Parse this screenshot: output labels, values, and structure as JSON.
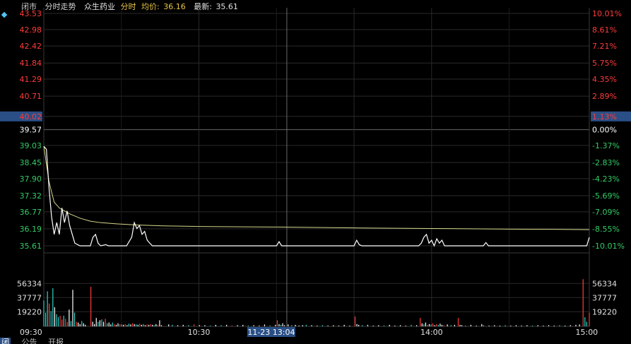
{
  "header": {
    "status": "闭市",
    "mode": "分时走势",
    "stock_name": "众生药业",
    "period": "分时",
    "avg_label": "均价:",
    "avg_value": "36.16",
    "latest_label": "最新:",
    "latest_value": "35.61"
  },
  "tabs": [
    {
      "label": "闭",
      "active": true
    },
    {
      "label": "公告",
      "active": false
    },
    {
      "label": "开报",
      "active": false
    }
  ],
  "colors": {
    "up": "#ff3b3b",
    "down": "#33cc66",
    "neutral": "#ffffff",
    "price_line": "#ffffff",
    "avg_line": "#d6d68a",
    "grid": "#2a2a2a",
    "highlight": "#2a4f86",
    "teal_bar": "#2fd2c7"
  },
  "crosshair_time": "11-23 13:04",
  "chart_data": {
    "type": "line",
    "title": "",
    "xlabel": "",
    "ylabel": "",
    "ylim": [
      35.61,
      43.53
    ],
    "prev_close": 39.57,
    "highlight_price": "40.02",
    "highlight_pct": "1.13%",
    "y_ticks_left": [
      "43.53",
      "42.98",
      "42.42",
      "41.84",
      "41.29",
      "40.71",
      "40.02",
      "39.57",
      "39.03",
      "38.45",
      "37.90",
      "37.32",
      "36.77",
      "36.19",
      "35.61"
    ],
    "y_tick_values": [
      43.53,
      42.98,
      42.42,
      41.84,
      41.29,
      40.71,
      40.02,
      39.57,
      39.03,
      38.45,
      37.9,
      37.32,
      36.77,
      36.19,
      35.61
    ],
    "y_ticks_right": [
      "10.01%",
      "8.61%",
      "7.21%",
      "5.75%",
      "4.35%",
      "2.89%",
      "1.13%",
      "0.00%",
      "-1.37%",
      "-2.83%",
      "-4.23%",
      "-5.69%",
      "-7.09%",
      "-8.55%",
      "-10.01%"
    ],
    "x_ticks": [
      "09:30",
      "10:30",
      "14:00",
      "15:00"
    ],
    "x_tick_minutes": [
      0,
      60,
      150,
      210
    ],
    "volume_ticks": [
      "56334",
      "37777",
      "19220"
    ],
    "volume_tick_values": [
      56334,
      37777,
      19220
    ],
    "volume_ylim": [
      0,
      90000
    ],
    "series": [
      {
        "role": "price",
        "points": [
          [
            0,
            39.0
          ],
          [
            1,
            38.9
          ],
          [
            2,
            37.6
          ],
          [
            3,
            36.6
          ],
          [
            4,
            36.0
          ],
          [
            5,
            36.4
          ],
          [
            6,
            36.0
          ],
          [
            7,
            36.9
          ],
          [
            8,
            36.4
          ],
          [
            9,
            36.8
          ],
          [
            10,
            36.3
          ],
          [
            11,
            36.0
          ],
          [
            12,
            35.7
          ],
          [
            14,
            35.61
          ],
          [
            16,
            35.61
          ],
          [
            18,
            35.61
          ],
          [
            19,
            35.9
          ],
          [
            20,
            36.0
          ],
          [
            21,
            35.7
          ],
          [
            22,
            35.61
          ],
          [
            24,
            35.65
          ],
          [
            25,
            35.61
          ],
          [
            28,
            35.61
          ],
          [
            30,
            35.61
          ],
          [
            32,
            35.61
          ],
          [
            34,
            35.9
          ],
          [
            35,
            36.4
          ],
          [
            36,
            36.2
          ],
          [
            37,
            36.3
          ],
          [
            38,
            36.0
          ],
          [
            39,
            36.1
          ],
          [
            40,
            35.8
          ],
          [
            41,
            35.7
          ],
          [
            42,
            35.61
          ],
          [
            45,
            35.61
          ],
          [
            60,
            35.61
          ],
          [
            80,
            35.61
          ],
          [
            90,
            35.61
          ],
          [
            91,
            35.75
          ],
          [
            92,
            35.61
          ],
          [
            110,
            35.61
          ],
          [
            120,
            35.61
          ],
          [
            121,
            35.8
          ],
          [
            122,
            35.65
          ],
          [
            123,
            35.61
          ],
          [
            145,
            35.61
          ],
          [
            146,
            35.7
          ],
          [
            147,
            35.9
          ],
          [
            148,
            36.0
          ],
          [
            149,
            35.7
          ],
          [
            150,
            35.8
          ],
          [
            151,
            35.61
          ],
          [
            152,
            35.85
          ],
          [
            153,
            35.7
          ],
          [
            154,
            35.8
          ],
          [
            155,
            35.61
          ],
          [
            160,
            35.61
          ],
          [
            170,
            35.61
          ],
          [
            171,
            35.72
          ],
          [
            172,
            35.61
          ],
          [
            200,
            35.61
          ],
          [
            205,
            35.61
          ],
          [
            209,
            35.61
          ],
          [
            210,
            35.61
          ],
          [
            211,
            35.9
          ]
        ]
      },
      {
        "role": "average",
        "points": [
          [
            0,
            39.0
          ],
          [
            2,
            37.8
          ],
          [
            4,
            37.1
          ],
          [
            6,
            36.9
          ],
          [
            8,
            36.8
          ],
          [
            10,
            36.7
          ],
          [
            14,
            36.55
          ],
          [
            18,
            36.45
          ],
          [
            22,
            36.4
          ],
          [
            28,
            36.36
          ],
          [
            36,
            36.32
          ],
          [
            46,
            36.29
          ],
          [
            60,
            36.27
          ],
          [
            90,
            36.25
          ],
          [
            120,
            36.22
          ],
          [
            150,
            36.2
          ],
          [
            180,
            36.18
          ],
          [
            200,
            36.17
          ],
          [
            211,
            36.16
          ]
        ]
      }
    ],
    "volume": [
      [
        0,
        34000,
        "teal"
      ],
      [
        0.7,
        18000,
        "teal"
      ],
      [
        1.4,
        46000,
        "teal"
      ],
      [
        2.1,
        30000,
        "up"
      ],
      [
        2.8,
        20000,
        "teal"
      ],
      [
        3.5,
        50000,
        "teal"
      ],
      [
        4.2,
        25000,
        "neutral"
      ],
      [
        4.9,
        16000,
        "teal"
      ],
      [
        5.6,
        12000,
        "teal"
      ],
      [
        6.3,
        14000,
        "up"
      ],
      [
        7,
        9000,
        "up"
      ],
      [
        7.7,
        14000,
        "teal"
      ],
      [
        8.4,
        10000,
        "up"
      ],
      [
        9.1,
        6000,
        "up"
      ],
      [
        9.8,
        22000,
        "neutral"
      ],
      [
        10.5,
        7000,
        "teal"
      ],
      [
        11.2,
        48000,
        "neutral"
      ],
      [
        11.9,
        18000,
        "teal"
      ],
      [
        12.6,
        6000,
        "up"
      ],
      [
        13.3,
        5000,
        "neutral"
      ],
      [
        14,
        3000,
        "neutral"
      ],
      [
        14.7,
        7000,
        "teal"
      ],
      [
        15.4,
        4000,
        "neutral"
      ],
      [
        16.1,
        2000,
        "neutral"
      ],
      [
        18.2,
        52000,
        "up"
      ],
      [
        18.9,
        6000,
        "neutral"
      ],
      [
        19.6,
        3000,
        "neutral"
      ],
      [
        20.3,
        11000,
        "neutral"
      ],
      [
        21,
        6000,
        "teal"
      ],
      [
        21.7,
        8000,
        "neutral"
      ],
      [
        22.4,
        9000,
        "teal"
      ],
      [
        23.1,
        6000,
        "neutral"
      ],
      [
        23.8,
        10000,
        "up"
      ],
      [
        24.5,
        4000,
        "teal"
      ],
      [
        25.2,
        5000,
        "neutral"
      ],
      [
        25.9,
        2500,
        "neutral"
      ],
      [
        26.6,
        5000,
        "teal"
      ],
      [
        27.3,
        3000,
        "up"
      ],
      [
        28,
        2000,
        "neutral"
      ],
      [
        28.7,
        4000,
        "neutral"
      ],
      [
        29.4,
        3000,
        "up"
      ],
      [
        30.1,
        2500,
        "teal"
      ],
      [
        30.8,
        2000,
        "neutral"
      ],
      [
        31.5,
        3000,
        "up"
      ],
      [
        32.2,
        1500,
        "neutral"
      ],
      [
        32.9,
        3500,
        "teal"
      ],
      [
        33.6,
        2500,
        "neutral"
      ],
      [
        34.3,
        4000,
        "up"
      ],
      [
        35,
        3000,
        "neutral"
      ],
      [
        35.7,
        2500,
        "teal"
      ],
      [
        36.4,
        2000,
        "neutral"
      ],
      [
        37.1,
        3500,
        "up"
      ],
      [
        37.8,
        2000,
        "neutral"
      ],
      [
        38.5,
        3000,
        "teal"
      ],
      [
        39.2,
        1500,
        "neutral"
      ],
      [
        39.9,
        2500,
        "up"
      ],
      [
        40.6,
        2000,
        "neutral"
      ],
      [
        41.3,
        3000,
        "up"
      ],
      [
        42,
        2000,
        "neutral"
      ],
      [
        42.7,
        1500,
        "teal"
      ],
      [
        43.4,
        3000,
        "neutral"
      ],
      [
        44.1,
        2000,
        "up"
      ],
      [
        44.8,
        8000,
        "neutral"
      ],
      [
        45.5,
        1500,
        "neutral"
      ],
      [
        48.3,
        2500,
        "neutral"
      ],
      [
        49.7,
        2000,
        "teal"
      ],
      [
        51.8,
        1500,
        "neutral"
      ],
      [
        53.9,
        2000,
        "neutral"
      ],
      [
        56,
        1500,
        "teal"
      ],
      [
        58.1,
        2500,
        "up"
      ],
      [
        60.2,
        1500,
        "neutral"
      ],
      [
        62.3,
        1500,
        "neutral"
      ],
      [
        64.4,
        1000,
        "teal"
      ],
      [
        66.5,
        2000,
        "neutral"
      ],
      [
        68.6,
        1500,
        "teal"
      ],
      [
        70.7,
        2000,
        "neutral"
      ],
      [
        72.8,
        1000,
        "up"
      ],
      [
        74.9,
        1500,
        "neutral"
      ],
      [
        77,
        2000,
        "neutral"
      ],
      [
        79.1,
        1000,
        "teal"
      ],
      [
        81.2,
        1500,
        "neutral"
      ],
      [
        83.3,
        1000,
        "neutral"
      ],
      [
        85.4,
        2500,
        "neutral"
      ],
      [
        87.5,
        1000,
        "teal"
      ],
      [
        89.6,
        2000,
        "neutral"
      ],
      [
        90.3,
        8000,
        "up"
      ],
      [
        91,
        3000,
        "neutral"
      ],
      [
        91.7,
        2000,
        "teal"
      ],
      [
        92.4,
        4000,
        "neutral"
      ],
      [
        93.1,
        1500,
        "neutral"
      ],
      [
        94.5,
        2500,
        "neutral"
      ],
      [
        95.9,
        1500,
        "teal"
      ],
      [
        97.3,
        2000,
        "neutral"
      ],
      [
        98.7,
        1000,
        "neutral"
      ],
      [
        100.1,
        1500,
        "neutral"
      ],
      [
        101.5,
        2000,
        "teal"
      ],
      [
        103.6,
        1500,
        "neutral"
      ],
      [
        105.7,
        1000,
        "neutral"
      ],
      [
        107.8,
        1500,
        "teal"
      ],
      [
        109.9,
        1000,
        "neutral"
      ],
      [
        112,
        1500,
        "neutral"
      ],
      [
        114.1,
        1000,
        "neutral"
      ],
      [
        116.2,
        2000,
        "neutral"
      ],
      [
        118.3,
        1000,
        "neutral"
      ],
      [
        120.4,
        13000,
        "up"
      ],
      [
        121.1,
        3000,
        "neutral"
      ],
      [
        121.8,
        2000,
        "neutral"
      ],
      [
        123.2,
        1500,
        "teal"
      ],
      [
        125.3,
        2000,
        "neutral"
      ],
      [
        127.4,
        1000,
        "neutral"
      ],
      [
        129.5,
        1500,
        "neutral"
      ],
      [
        131.6,
        1000,
        "teal"
      ],
      [
        133.7,
        2000,
        "neutral"
      ],
      [
        135.8,
        1000,
        "neutral"
      ],
      [
        137.9,
        1500,
        "neutral"
      ],
      [
        140,
        1000,
        "neutral"
      ],
      [
        142.1,
        2000,
        "teal"
      ],
      [
        144.2,
        1500,
        "neutral"
      ],
      [
        145.6,
        11000,
        "up"
      ],
      [
        146.3,
        4000,
        "neutral"
      ],
      [
        147,
        3000,
        "teal"
      ],
      [
        147.7,
        5000,
        "neutral"
      ],
      [
        148.4,
        2000,
        "up"
      ],
      [
        149.1,
        3000,
        "neutral"
      ],
      [
        149.8,
        2500,
        "teal"
      ],
      [
        150.5,
        4000,
        "up"
      ],
      [
        151.2,
        1500,
        "neutral"
      ],
      [
        151.9,
        3000,
        "up"
      ],
      [
        152.6,
        2000,
        "teal"
      ],
      [
        153.3,
        3500,
        "neutral"
      ],
      [
        154,
        2000,
        "neutral"
      ],
      [
        154.7,
        1500,
        "up"
      ],
      [
        156.1,
        2500,
        "neutral"
      ],
      [
        157.5,
        1500,
        "teal"
      ],
      [
        158.9,
        2000,
        "neutral"
      ],
      [
        160.3,
        11000,
        "up"
      ],
      [
        161,
        2000,
        "neutral"
      ],
      [
        161.7,
        1500,
        "neutral"
      ],
      [
        163.1,
        1000,
        "teal"
      ],
      [
        165.2,
        2000,
        "neutral"
      ],
      [
        167.3,
        1000,
        "neutral"
      ],
      [
        169.4,
        3000,
        "neutral"
      ],
      [
        170.1,
        1500,
        "teal"
      ],
      [
        172.2,
        1000,
        "neutral"
      ],
      [
        174.3,
        1500,
        "neutral"
      ],
      [
        176.4,
        1000,
        "neutral"
      ],
      [
        178.5,
        1500,
        "teal"
      ],
      [
        180.6,
        1000,
        "neutral"
      ],
      [
        182.7,
        1500,
        "neutral"
      ],
      [
        184.8,
        1000,
        "neutral"
      ],
      [
        186.9,
        1500,
        "neutral"
      ],
      [
        189,
        1000,
        "teal"
      ],
      [
        191.1,
        1500,
        "neutral"
      ],
      [
        193.2,
        1000,
        "neutral"
      ],
      [
        195.3,
        1500,
        "neutral"
      ],
      [
        197.4,
        1000,
        "neutral"
      ],
      [
        199.5,
        1500,
        "teal"
      ],
      [
        201.6,
        1000,
        "neutral"
      ],
      [
        203.7,
        1500,
        "neutral"
      ],
      [
        205.8,
        2000,
        "neutral"
      ],
      [
        207.2,
        2500,
        "neutral"
      ],
      [
        208.6,
        62000,
        "up"
      ],
      [
        209.3,
        12000,
        "teal"
      ],
      [
        210,
        6000,
        "teal"
      ],
      [
        211,
        18000,
        "up"
      ]
    ]
  }
}
